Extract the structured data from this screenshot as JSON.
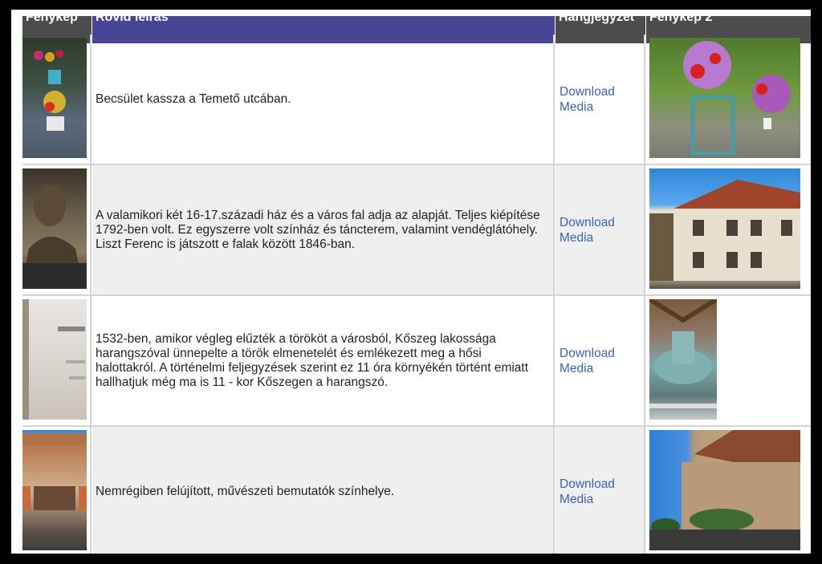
{
  "headers": {
    "foto": "Fénykép",
    "leiras": "Rövid leírás",
    "hang": "Hangjegyzet",
    "foto2": "Fénykép 2"
  },
  "rows": [
    {
      "description": "Becsület kassza a Temető utcában.",
      "download_line1": "Download",
      "download_line2": "Media"
    },
    {
      "description": "A valamikori két 16-17.századi ház és a város fal adja az alapját. Teljes kiépítése 1792-ben volt. Ez egyszerre volt színház és táncterem, valamint vendéglátóhely. Liszt Ferenc is játszott e falak között 1846-ban.",
      "download_line1": "Download",
      "download_line2": "Media"
    },
    {
      "description": "1532-ben, amikor végleg elűzték a törököt a városból, Kőszeg lakossága harangszóval ünnepelte a török elmenetelét és emlékezett meg a hősi halottakról. A történelmi feljegyzések szerint ez 11 óra környékén történt emiatt hallhatjuk még ma is 11 - kor Kőszegen a harangszó.",
      "download_line1": "Download",
      "download_line2": "Media"
    },
    {
      "description": "Nemrégiben felújított, művészeti bemutatók színhelye.",
      "download_line1": "Download",
      "download_line2": "Media"
    }
  ],
  "colors": {
    "header_dark": "#4c4c4c",
    "header_accent": "#474594",
    "link": "#3a64b0",
    "row_alt": "#efefef"
  }
}
